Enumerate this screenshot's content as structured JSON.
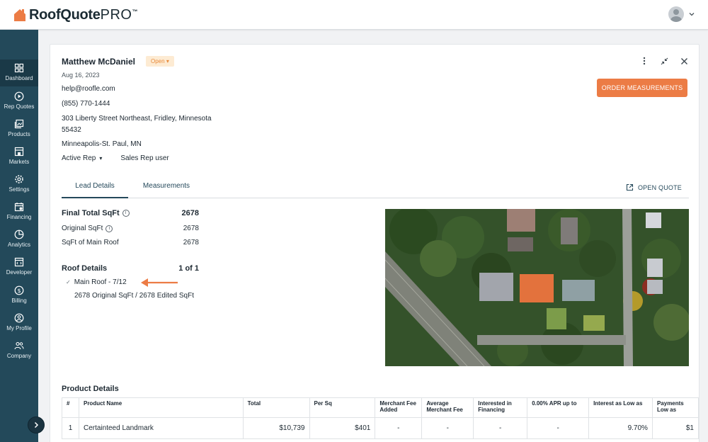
{
  "header": {
    "logo_bold": "RoofQuote",
    "logo_pro": "PRO",
    "logo_tm": "™"
  },
  "sidebar": {
    "items": [
      {
        "label": "Dashboard",
        "icon": "dashboard-icon",
        "active": true
      },
      {
        "label": "Rep Quotes",
        "icon": "play-circle-icon"
      },
      {
        "label": "Products",
        "icon": "gallery-icon"
      },
      {
        "label": "Markets",
        "icon": "store-icon"
      },
      {
        "label": "Settings",
        "icon": "gear-icon"
      },
      {
        "label": "Financing",
        "icon": "calendar-dollar-icon"
      },
      {
        "label": "Analytics",
        "icon": "pie-chart-icon"
      },
      {
        "label": "Developer",
        "icon": "code-window-icon"
      },
      {
        "label": "Billing",
        "icon": "dollar-circle-icon"
      },
      {
        "label": "My Profile",
        "icon": "user-circle-icon"
      },
      {
        "label": "Company",
        "icon": "users-icon"
      }
    ]
  },
  "lead": {
    "name": "Matthew McDaniel",
    "status": "Open",
    "date": "Aug 16, 2023",
    "email": "help@roofle.com",
    "phone": "(855) 770-1444",
    "address_line1": "303 Liberty Street Northeast, Fridley, Minnesota",
    "address_line2": "55432",
    "market": "Minneapolis-St. Paul, MN",
    "rep_status": "Active Rep",
    "rep_name": "Sales Rep user"
  },
  "actions": {
    "order_label": "ORDER MEASUREMENTS",
    "open_quote_label": "OPEN QUOTE"
  },
  "tabs": [
    {
      "label": "Lead Details",
      "active": true
    },
    {
      "label": "Measurements",
      "active": false
    }
  ],
  "metrics": {
    "final_total_label": "Final Total SqFt",
    "final_total_value": "2678",
    "original_label": "Original SqFt",
    "original_value": "2678",
    "main_roof_label": "SqFt of Main Roof",
    "main_roof_value": "2678"
  },
  "roof_details": {
    "title": "Roof Details",
    "count": "1 of 1",
    "item_label": "Main Roof - 7/12",
    "item_sub": "2678 Original SqFt / 2678 Edited SqFt"
  },
  "product_details": {
    "title": "Product Details",
    "columns": [
      "#",
      "Product Name",
      "Total",
      "Per Sq",
      "Merchant Fee Added",
      "Average Merchant Fee",
      "Interested in Financing",
      "0.00% APR up to",
      "Interest as Low as",
      "Payments Low as"
    ],
    "rows": [
      [
        "1",
        "Certainteed Landmark",
        "$10,739",
        "$401",
        "-",
        "-",
        "-",
        "-",
        "9.70%",
        "$1"
      ]
    ]
  },
  "colors": {
    "accent": "#ec7c45",
    "sidebar": "#23495a",
    "badge_bg": "#fdebd3"
  }
}
